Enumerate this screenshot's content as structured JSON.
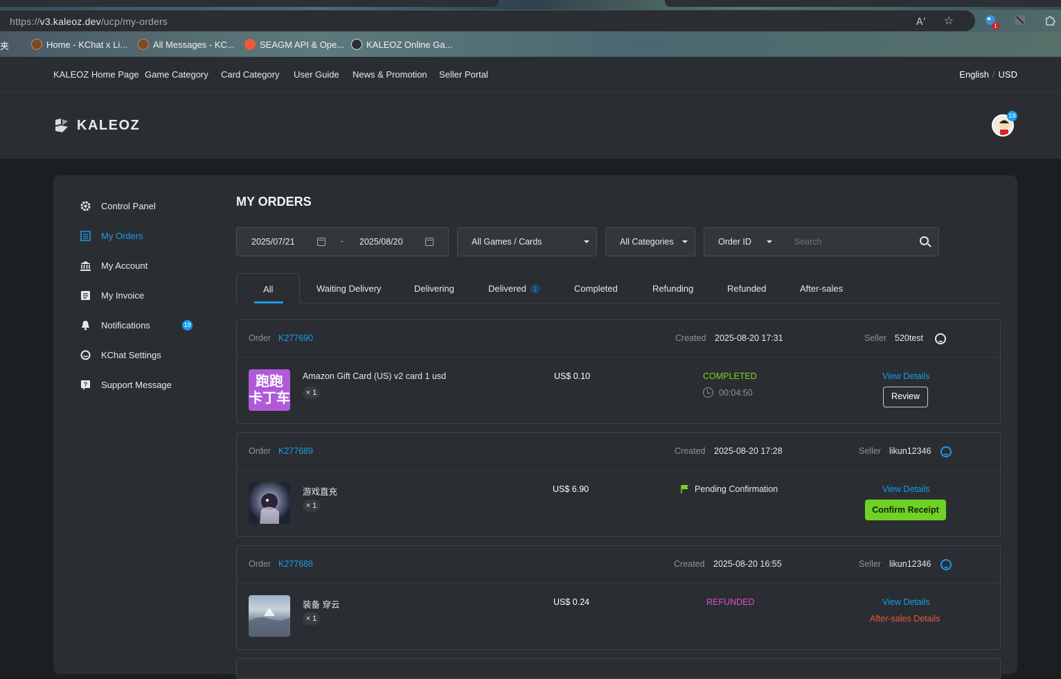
{
  "browser": {
    "url_prefix": "https://",
    "url_host": "v3.kaleoz.dev",
    "url_path": "/ucp/my-orders",
    "ext_badge": "1",
    "bookmarks": [
      {
        "label": "夹"
      },
      {
        "label": "Home - KChat x Li..."
      },
      {
        "label": "All Messages - KC..."
      },
      {
        "label": "SEAGM API & Ope..."
      },
      {
        "label": "KALEOZ Online Ga..."
      }
    ]
  },
  "topnav": {
    "links": [
      "KALEOZ Home Page",
      "Game Category",
      "Card Category",
      "User Guide",
      "News & Promotion",
      "Seller Portal"
    ],
    "language": "English",
    "separator": "/",
    "currency": "USD"
  },
  "header": {
    "logo_text": "KALEOZ",
    "avatar_badge": "19"
  },
  "sidebar": {
    "items": [
      {
        "label": "Control Panel",
        "icon": "gear-icon"
      },
      {
        "label": "My Orders",
        "icon": "list-icon"
      },
      {
        "label": "My Account",
        "icon": "bank-icon"
      },
      {
        "label": "My Invoice",
        "icon": "invoice-icon"
      },
      {
        "label": "Notifications",
        "icon": "bell-icon"
      },
      {
        "label": "KChat Settings",
        "icon": "chat-icon"
      },
      {
        "label": "Support Message",
        "icon": "help-icon"
      }
    ],
    "notif_badge": "19"
  },
  "main": {
    "title": "MY ORDERS",
    "filters": {
      "date_from": "2025/07/21",
      "date_sep": "-",
      "date_to": "2025/08/20",
      "games": "All Games / Cards",
      "categories": "All Categories",
      "search_by": "Order ID",
      "search_placeholder": "Search"
    },
    "tabs": [
      {
        "label": "All"
      },
      {
        "label": "Waiting Delivery"
      },
      {
        "label": "Delivering"
      },
      {
        "label": "Delivered",
        "count": "1"
      },
      {
        "label": "Completed"
      },
      {
        "label": "Refunding"
      },
      {
        "label": "Refunded"
      },
      {
        "label": "After-sales"
      }
    ],
    "labels": {
      "order": "Order",
      "created": "Created",
      "seller": "Seller",
      "view_details": "View Details"
    },
    "orders": [
      {
        "id": "K277690",
        "created": "2025-08-20 17:31",
        "seller": "520test",
        "product": "Amazon Gift Card (US) v2 card 1 usd",
        "thumb_text_1": "跑跑",
        "thumb_text_2": "卡丁车",
        "qty": "× 1",
        "price": "US$ 0.10",
        "status": "COMPLETED",
        "status_color": "#7ed321",
        "timer": "00:04:50",
        "action": "Review"
      },
      {
        "id": "K277689",
        "created": "2025-08-20 17:28",
        "seller": "likun12346",
        "product": "游戏直充",
        "qty": "× 1",
        "price": "US$ 6.90",
        "status": "Pending Confirmation",
        "status_color": "#e6e8eb",
        "action": "Confirm Receipt"
      },
      {
        "id": "K277688",
        "created": "2025-08-20 16:55",
        "seller": "likun12346",
        "product": "装备 穿云",
        "qty": "× 1",
        "price": "US$ 0.24",
        "status": "REFUNDED",
        "status_color": "#e04bd6",
        "action": "After-sales Details"
      }
    ]
  }
}
